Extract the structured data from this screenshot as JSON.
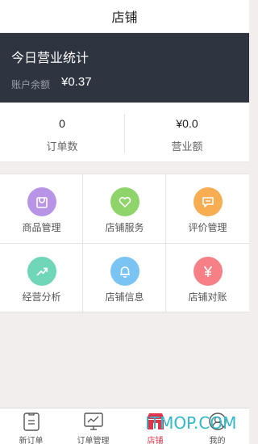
{
  "header": {
    "title": "店铺"
  },
  "banner": {
    "title": "今日营业统计",
    "balance_label": "账户余额",
    "balance_value": "¥0.37"
  },
  "summary": {
    "orders": {
      "value": "0",
      "label": "订单数"
    },
    "revenue": {
      "value": "¥0.0",
      "label": "营业额"
    }
  },
  "grid": {
    "items": [
      {
        "label": "商品管理",
        "icon": "bag-icon",
        "color": "#b794e6"
      },
      {
        "label": "店铺服务",
        "icon": "heart-icon",
        "color": "#8fd46a"
      },
      {
        "label": "评价管理",
        "icon": "comment-icon",
        "color": "#f7ad52"
      },
      {
        "label": "经营分析",
        "icon": "trend-icon",
        "color": "#6fd6b8"
      },
      {
        "label": "店铺信息",
        "icon": "bell-icon",
        "color": "#79c4f2"
      },
      {
        "label": "店铺对账",
        "icon": "yen-icon",
        "color": "#f77f86"
      }
    ]
  },
  "tabbar": {
    "items": [
      {
        "label": "新订单",
        "icon": "order-doc-icon"
      },
      {
        "label": "订单管理",
        "icon": "monitor-icon"
      },
      {
        "label": "店铺",
        "icon": "shop-icon"
      },
      {
        "label": "我的",
        "icon": "user-icon"
      }
    ],
    "active_color": "#e0344b"
  },
  "watermark": {
    "text": "ITMOP.COM"
  }
}
